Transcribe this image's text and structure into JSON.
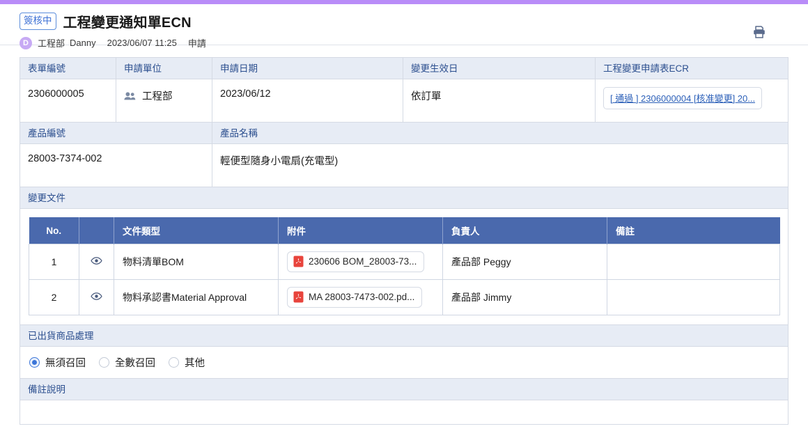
{
  "theme": {
    "accent_bar": "#b98cf8",
    "header_blue": "#4a69ad",
    "label_blue": "#2c4f8f",
    "link_blue": "#2b5fb8",
    "radio_blue": "#3b75d8",
    "pdf_red": "#e8443c"
  },
  "header": {
    "status_badge": "簽核中",
    "title": "工程變更通知單ECN",
    "avatar_initial": "D",
    "department": "工程部",
    "user": "Danny",
    "datetime": "2023/06/07 11:25",
    "action": "申請",
    "print_icon": "printer-icon"
  },
  "form_info": {
    "labels": {
      "form_no": "表單編號",
      "apply_dept": "申請單位",
      "apply_date": "申請日期",
      "effective_date": "變更生效日",
      "ecr": "工程變更申請表ECR"
    },
    "values": {
      "form_no": "2306000005",
      "apply_dept": "工程部",
      "apply_date": "2023/06/12",
      "effective_date": "依訂單",
      "ecr_link": "[ 通過 ] 2306000004 [核准變更] 20..."
    }
  },
  "product": {
    "labels": {
      "product_no": "產品編號",
      "product_name": "產品名稱"
    },
    "values": {
      "product_no": "28003-7374-002",
      "product_name": "輕便型隨身小電扇(充電型)"
    }
  },
  "change_docs": {
    "section_title": "變更文件",
    "columns": [
      "No.",
      "",
      "文件類型",
      "附件",
      "負責人",
      "備註"
    ],
    "rows": [
      {
        "no": "1",
        "eye": "eye-icon",
        "doc_type": "物料清單BOM",
        "attachment": "230606 BOM_28003-73...",
        "owner": "產品部 Peggy",
        "note": ""
      },
      {
        "no": "2",
        "eye": "eye-icon",
        "doc_type": "物料承認書Material Approval",
        "attachment": "MA 28003-7473-002.pd...",
        "owner": "產品部 Jimmy",
        "note": ""
      }
    ]
  },
  "shipped_handling": {
    "section_title": "已出貨商品處理",
    "options": [
      {
        "label": "無須召回",
        "selected": true
      },
      {
        "label": "全數召回",
        "selected": false
      },
      {
        "label": "其他",
        "selected": false
      }
    ]
  },
  "remark": {
    "section_title": "備註說明",
    "value": ""
  }
}
